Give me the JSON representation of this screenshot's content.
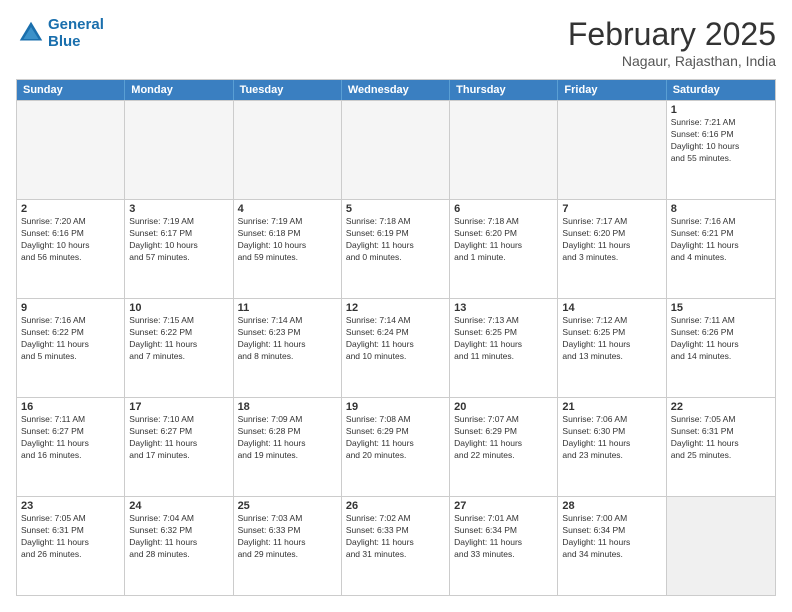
{
  "header": {
    "logo_line1": "General",
    "logo_line2": "Blue",
    "month": "February 2025",
    "location": "Nagaur, Rajasthan, India"
  },
  "weekdays": [
    "Sunday",
    "Monday",
    "Tuesday",
    "Wednesday",
    "Thursday",
    "Friday",
    "Saturday"
  ],
  "rows": [
    [
      {
        "day": "",
        "info": "",
        "empty": true
      },
      {
        "day": "",
        "info": "",
        "empty": true
      },
      {
        "day": "",
        "info": "",
        "empty": true
      },
      {
        "day": "",
        "info": "",
        "empty": true
      },
      {
        "day": "",
        "info": "",
        "empty": true
      },
      {
        "day": "",
        "info": "",
        "empty": true
      },
      {
        "day": "1",
        "info": "Sunrise: 7:21 AM\nSunset: 6:16 PM\nDaylight: 10 hours\nand 55 minutes.",
        "empty": false
      }
    ],
    [
      {
        "day": "2",
        "info": "Sunrise: 7:20 AM\nSunset: 6:16 PM\nDaylight: 10 hours\nand 56 minutes.",
        "empty": false
      },
      {
        "day": "3",
        "info": "Sunrise: 7:19 AM\nSunset: 6:17 PM\nDaylight: 10 hours\nand 57 minutes.",
        "empty": false
      },
      {
        "day": "4",
        "info": "Sunrise: 7:19 AM\nSunset: 6:18 PM\nDaylight: 10 hours\nand 59 minutes.",
        "empty": false
      },
      {
        "day": "5",
        "info": "Sunrise: 7:18 AM\nSunset: 6:19 PM\nDaylight: 11 hours\nand 0 minutes.",
        "empty": false
      },
      {
        "day": "6",
        "info": "Sunrise: 7:18 AM\nSunset: 6:20 PM\nDaylight: 11 hours\nand 1 minute.",
        "empty": false
      },
      {
        "day": "7",
        "info": "Sunrise: 7:17 AM\nSunset: 6:20 PM\nDaylight: 11 hours\nand 3 minutes.",
        "empty": false
      },
      {
        "day": "8",
        "info": "Sunrise: 7:16 AM\nSunset: 6:21 PM\nDaylight: 11 hours\nand 4 minutes.",
        "empty": false
      }
    ],
    [
      {
        "day": "9",
        "info": "Sunrise: 7:16 AM\nSunset: 6:22 PM\nDaylight: 11 hours\nand 5 minutes.",
        "empty": false
      },
      {
        "day": "10",
        "info": "Sunrise: 7:15 AM\nSunset: 6:22 PM\nDaylight: 11 hours\nand 7 minutes.",
        "empty": false
      },
      {
        "day": "11",
        "info": "Sunrise: 7:14 AM\nSunset: 6:23 PM\nDaylight: 11 hours\nand 8 minutes.",
        "empty": false
      },
      {
        "day": "12",
        "info": "Sunrise: 7:14 AM\nSunset: 6:24 PM\nDaylight: 11 hours\nand 10 minutes.",
        "empty": false
      },
      {
        "day": "13",
        "info": "Sunrise: 7:13 AM\nSunset: 6:25 PM\nDaylight: 11 hours\nand 11 minutes.",
        "empty": false
      },
      {
        "day": "14",
        "info": "Sunrise: 7:12 AM\nSunset: 6:25 PM\nDaylight: 11 hours\nand 13 minutes.",
        "empty": false
      },
      {
        "day": "15",
        "info": "Sunrise: 7:11 AM\nSunset: 6:26 PM\nDaylight: 11 hours\nand 14 minutes.",
        "empty": false
      }
    ],
    [
      {
        "day": "16",
        "info": "Sunrise: 7:11 AM\nSunset: 6:27 PM\nDaylight: 11 hours\nand 16 minutes.",
        "empty": false
      },
      {
        "day": "17",
        "info": "Sunrise: 7:10 AM\nSunset: 6:27 PM\nDaylight: 11 hours\nand 17 minutes.",
        "empty": false
      },
      {
        "day": "18",
        "info": "Sunrise: 7:09 AM\nSunset: 6:28 PM\nDaylight: 11 hours\nand 19 minutes.",
        "empty": false
      },
      {
        "day": "19",
        "info": "Sunrise: 7:08 AM\nSunset: 6:29 PM\nDaylight: 11 hours\nand 20 minutes.",
        "empty": false
      },
      {
        "day": "20",
        "info": "Sunrise: 7:07 AM\nSunset: 6:29 PM\nDaylight: 11 hours\nand 22 minutes.",
        "empty": false
      },
      {
        "day": "21",
        "info": "Sunrise: 7:06 AM\nSunset: 6:30 PM\nDaylight: 11 hours\nand 23 minutes.",
        "empty": false
      },
      {
        "day": "22",
        "info": "Sunrise: 7:05 AM\nSunset: 6:31 PM\nDaylight: 11 hours\nand 25 minutes.",
        "empty": false
      }
    ],
    [
      {
        "day": "23",
        "info": "Sunrise: 7:05 AM\nSunset: 6:31 PM\nDaylight: 11 hours\nand 26 minutes.",
        "empty": false
      },
      {
        "day": "24",
        "info": "Sunrise: 7:04 AM\nSunset: 6:32 PM\nDaylight: 11 hours\nand 28 minutes.",
        "empty": false
      },
      {
        "day": "25",
        "info": "Sunrise: 7:03 AM\nSunset: 6:33 PM\nDaylight: 11 hours\nand 29 minutes.",
        "empty": false
      },
      {
        "day": "26",
        "info": "Sunrise: 7:02 AM\nSunset: 6:33 PM\nDaylight: 11 hours\nand 31 minutes.",
        "empty": false
      },
      {
        "day": "27",
        "info": "Sunrise: 7:01 AM\nSunset: 6:34 PM\nDaylight: 11 hours\nand 33 minutes.",
        "empty": false
      },
      {
        "day": "28",
        "info": "Sunrise: 7:00 AM\nSunset: 6:34 PM\nDaylight: 11 hours\nand 34 minutes.",
        "empty": false
      },
      {
        "day": "",
        "info": "",
        "empty": true,
        "shaded": true
      }
    ]
  ]
}
